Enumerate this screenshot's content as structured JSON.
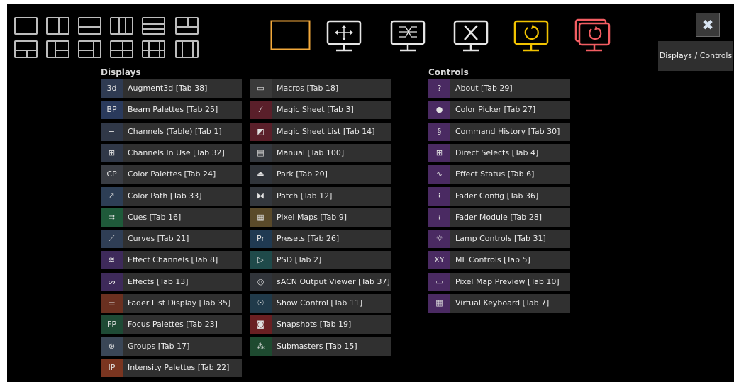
{
  "tab_label": "Displays / Controls",
  "close_glyph": "✖",
  "layouts_row1": [
    "layout-single",
    "layout-split-vertical",
    "layout-split-horizontal",
    "layout-three-columns",
    "layout-three-rows",
    "layout-top-split"
  ],
  "layouts_row2": [
    "layout-bottom-split",
    "layout-left-tall",
    "layout-right-tall",
    "layout-quad",
    "layout-center-wide",
    "layout-side-columns"
  ],
  "monitors": [
    {
      "name": "frame-display-icon",
      "color": "#f2a93b"
    },
    {
      "name": "move-display-icon",
      "color": "#e6e6e6"
    },
    {
      "name": "patch-display-icon",
      "color": "#e6e6e6"
    },
    {
      "name": "close-display-icon",
      "color": "#e6e6e6"
    },
    {
      "name": "refresh-display-icon",
      "color": "#f2c300"
    },
    {
      "name": "refresh-all-displays-icon",
      "color": "#f25d62"
    }
  ],
  "displays": {
    "heading": "Displays",
    "col1": [
      {
        "label": "Augment3d [Tab 38]",
        "icon": "3d",
        "icon_name": "augment3d-icon",
        "color": "#2f3b52"
      },
      {
        "label": "Beam Palettes [Tab 25]",
        "icon": "BP",
        "icon_name": "beam-palettes-icon",
        "color": "#2a3a5c"
      },
      {
        "label": "Channels (Table) [Tab 1]",
        "icon": "≡",
        "icon_name": "channels-table-icon",
        "color": "#303848"
      },
      {
        "label": "Channels In Use [Tab 32]",
        "icon": "⊞",
        "icon_name": "channels-in-use-icon",
        "color": "#303848"
      },
      {
        "label": "Color Palettes [Tab 24]",
        "icon": "CP",
        "icon_name": "color-palettes-icon",
        "color": "#3a3d44"
      },
      {
        "label": "Color Path [Tab 33]",
        "icon": "⤤",
        "icon_name": "color-path-icon",
        "color": "#2d3e55"
      },
      {
        "label": "Cues [Tab 16]",
        "icon": "⇉",
        "icon_name": "cues-icon",
        "color": "#1f5a3a"
      },
      {
        "label": "Curves [Tab 21]",
        "icon": "⟋",
        "icon_name": "curves-icon",
        "color": "#2f3e55"
      },
      {
        "label": "Effect Channels [Tab 8]",
        "icon": "≋",
        "icon_name": "effect-channels-icon",
        "color": "#3e2a5a"
      },
      {
        "label": "Effects [Tab 13]",
        "icon": "ᔕ",
        "icon_name": "effects-icon",
        "color": "#3e2a5a"
      },
      {
        "label": "Fader List Display [Tab 35]",
        "icon": "☰",
        "icon_name": "fader-list-icon",
        "color": "#6a3020"
      },
      {
        "label": "Focus Palettes [Tab 23]",
        "icon": "FP",
        "icon_name": "focus-palettes-icon",
        "color": "#1e4a35"
      },
      {
        "label": "Groups [Tab 17]",
        "icon": "⊛",
        "icon_name": "groups-icon",
        "color": "#3a4656"
      },
      {
        "label": "Intensity Palettes [Tab 22]",
        "icon": "IP",
        "icon_name": "intensity-palettes-icon",
        "color": "#7a3520"
      }
    ],
    "col2": [
      {
        "label": "Macros [Tab 18]",
        "icon": "▭",
        "icon_name": "macros-icon",
        "color": "#3a3a3a"
      },
      {
        "label": "Magic Sheet [Tab 3]",
        "icon": "⁄",
        "icon_name": "magic-sheet-icon",
        "color": "#5a1f2a"
      },
      {
        "label": "Magic Sheet List [Tab 14]",
        "icon": "◩",
        "icon_name": "magic-sheet-list-icon",
        "color": "#5a1f2a"
      },
      {
        "label": "Manual [Tab 100]",
        "icon": "▤",
        "icon_name": "manual-icon",
        "color": "#33373d"
      },
      {
        "label": "Park [Tab 20]",
        "icon": "⏏",
        "icon_name": "park-icon",
        "color": "#30343a"
      },
      {
        "label": "Patch [Tab 12]",
        "icon": "⧓",
        "icon_name": "patch-icon",
        "color": "#33373d"
      },
      {
        "label": "Pixel Maps [Tab 9]",
        "icon": "▦",
        "icon_name": "pixel-maps-icon",
        "color": "#5a4a2a"
      },
      {
        "label": "Presets [Tab 26]",
        "icon": "Pr",
        "icon_name": "presets-icon",
        "color": "#203a52"
      },
      {
        "label": "PSD [Tab 2]",
        "icon": "▷",
        "icon_name": "psd-icon",
        "color": "#1f4a4a"
      },
      {
        "label": "sACN Output Viewer [Tab 37]",
        "icon": "◎",
        "icon_name": "sacn-output-viewer-icon",
        "color": "#30343a"
      },
      {
        "label": "Show Control [Tab 11]",
        "icon": "☉",
        "icon_name": "show-control-icon",
        "color": "#203a4a"
      },
      {
        "label": "Snapshots [Tab 19]",
        "icon": "◙",
        "icon_name": "snapshots-icon",
        "color": "#6a1f22"
      },
      {
        "label": "Submasters [Tab 15]",
        "icon": "⁂",
        "icon_name": "submasters-icon",
        "color": "#1e4a30"
      }
    ]
  },
  "controls": {
    "heading": "Controls",
    "items": [
      {
        "label": "About [Tab 29]",
        "icon": "?",
        "icon_name": "about-icon",
        "color": "#4a2a62"
      },
      {
        "label": "Color Picker [Tab 27]",
        "icon": "●",
        "icon_name": "color-picker-icon",
        "color": "#4a2a62"
      },
      {
        "label": "Command History [Tab 30]",
        "icon": "§",
        "icon_name": "command-history-icon",
        "color": "#4a2a62"
      },
      {
        "label": "Direct Selects [Tab 4]",
        "icon": "⊞",
        "icon_name": "direct-selects-icon",
        "color": "#4a2a62"
      },
      {
        "label": "Effect Status [Tab 6]",
        "icon": "∿",
        "icon_name": "effect-status-icon",
        "color": "#4a2a62"
      },
      {
        "label": "Fader Config [Tab 36]",
        "icon": "⁞",
        "icon_name": "fader-config-icon",
        "color": "#4a2a62"
      },
      {
        "label": "Fader Module [Tab 28]",
        "icon": "⁝",
        "icon_name": "fader-module-icon",
        "color": "#4a2a62"
      },
      {
        "label": "Lamp Controls [Tab 31]",
        "icon": "☼",
        "icon_name": "lamp-controls-icon",
        "color": "#4a2a62"
      },
      {
        "label": "ML Controls [Tab 5]",
        "icon": "XY",
        "icon_name": "ml-controls-icon",
        "color": "#4a2a62"
      },
      {
        "label": "Pixel Map Preview [Tab 10]",
        "icon": "▭",
        "icon_name": "pixel-map-preview-icon",
        "color": "#4a2a62"
      },
      {
        "label": "Virtual Keyboard [Tab 7]",
        "icon": "▦",
        "icon_name": "virtual-keyboard-icon",
        "color": "#4a2a62"
      }
    ]
  }
}
